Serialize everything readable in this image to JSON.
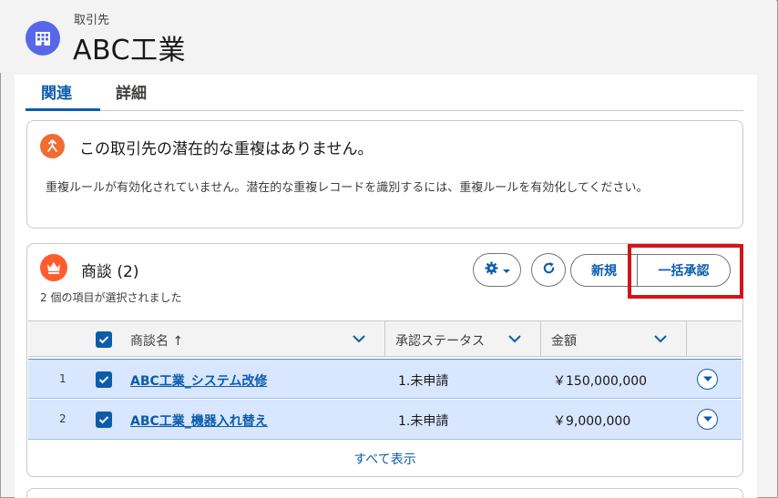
{
  "record": {
    "object_label": "取引先",
    "name": "ABC工業",
    "icon": "building-icon",
    "accent": "#5867e8"
  },
  "tabs": [
    {
      "label": "関連",
      "active": true
    },
    {
      "label": "詳細",
      "active": false
    }
  ],
  "duplicates": {
    "icon": "merge-icon",
    "title": "この取引先の潜在的な重複はありません。",
    "message": "重複ルールが有効化されていません。潜在的な重複レコードを識別するには、重複ルールを有効化してください。"
  },
  "opportunities": {
    "icon": "crown-icon",
    "title": "商談 (2)",
    "selection_text": "2 個の項目が選択されました",
    "buttons": {
      "new": "新規",
      "bulk_approve": "一括承認"
    },
    "columns": [
      {
        "label": "商談名 ↑"
      },
      {
        "label": "承認ステータス"
      },
      {
        "label": "金額"
      }
    ],
    "rows": [
      {
        "num": "1",
        "name": "ABC工業_システム改修",
        "status": "1.未申請",
        "amount": "￥150,000,000",
        "checked": true
      },
      {
        "num": "2",
        "name": "ABC工業_機器入れ替え",
        "status": "1.未申請",
        "amount": "￥9,000,000",
        "checked": true
      }
    ],
    "view_all": "すべて表示"
  },
  "colors": {
    "link": "#0b5cab",
    "selected_row": "#d8e6fe",
    "highlight": "#d3141a"
  }
}
